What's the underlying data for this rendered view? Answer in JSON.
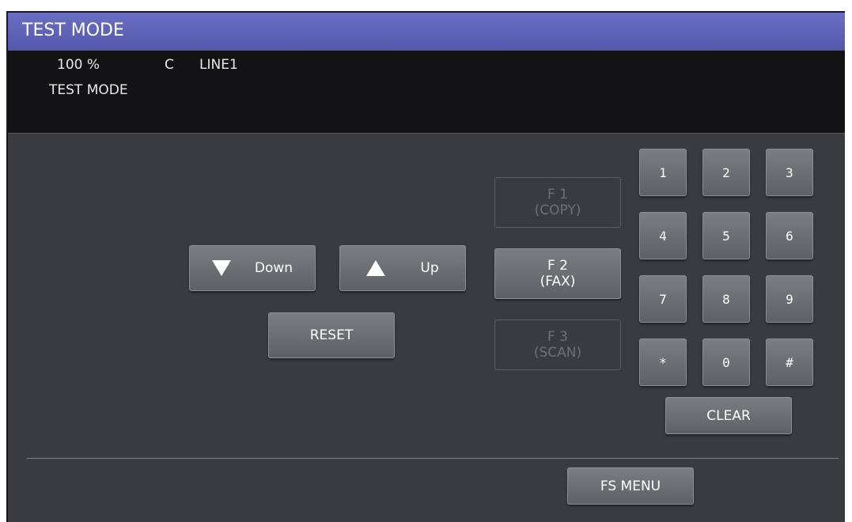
{
  "window": {
    "title": "TEST MODE"
  },
  "status": {
    "zoom": "100 %",
    "color_mode": "C",
    "line": "LINE1",
    "mode_text": "TEST MODE"
  },
  "controls": {
    "down_label": "Down",
    "up_label": "Up",
    "reset_label": "RESET"
  },
  "function_keys": [
    {
      "line1": "F 1",
      "line2": "(COPY)",
      "enabled": false
    },
    {
      "line1": "F 2",
      "line2": "(FAX)",
      "enabled": true
    },
    {
      "line1": "F 3",
      "line2": "(SCAN)",
      "enabled": false
    }
  ],
  "keypad": {
    "keys": [
      "1",
      "2",
      "3",
      "4",
      "5",
      "6",
      "7",
      "8",
      "9",
      "*",
      "0",
      "#"
    ],
    "clear_label": "CLEAR"
  },
  "footer": {
    "fs_menu_label": "FS MENU"
  },
  "colors": {
    "title_bar": "#5f63b8",
    "panel": "#3a3b3f",
    "status_bg": "#131315"
  }
}
